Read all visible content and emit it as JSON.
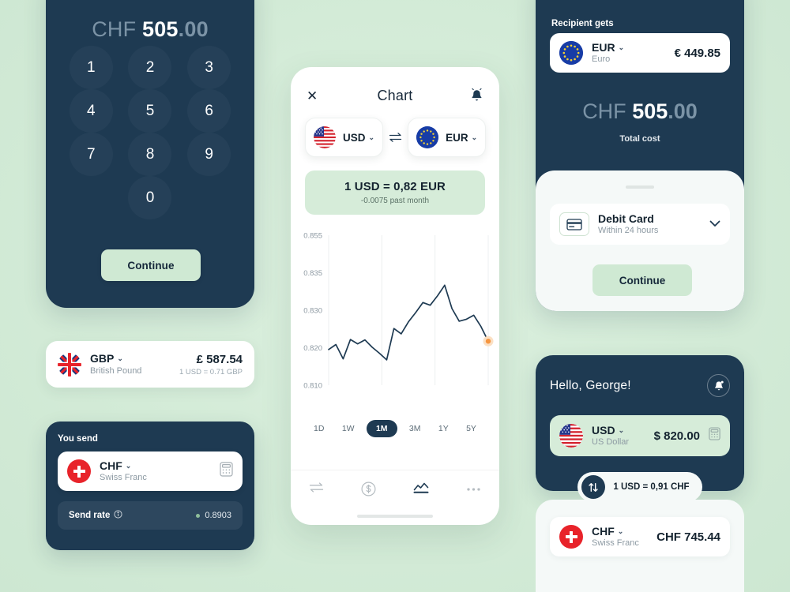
{
  "theme": {
    "background": "#d3ebd7",
    "navy": "#1e3a52",
    "mint_accent": "#cfe9d3",
    "mint_light": "#d6ecd9",
    "white": "#ffffff",
    "muted": "#8d9aa3",
    "marker": "#f6953f"
  },
  "keypad_screen": {
    "amount": {
      "currency": "CHF",
      "integer": "505",
      "decimal": ".00"
    },
    "keys": [
      "1",
      "2",
      "3",
      "4",
      "5",
      "6",
      "7",
      "8",
      "9",
      "0"
    ],
    "continue_label": "Continue"
  },
  "gbp_card": {
    "flag": "uk-flag-icon",
    "code": "GBP",
    "name": "British Pound",
    "amount": "£ 587.54",
    "rate": "1 USD = 0.71 GBP"
  },
  "you_send": {
    "title": "You send",
    "currency": {
      "flag": "switzerland-flag-icon",
      "code": "CHF",
      "name": "Swiss Franc"
    },
    "calculator_icon": "calculator-icon",
    "send_rate": {
      "label": "Send rate",
      "info_icon": "info-icon",
      "value": "0.8903"
    }
  },
  "chart_screen": {
    "close_icon": "close-icon",
    "title": "Chart",
    "bell_icon": "bell-icon",
    "from": {
      "flag": "usa-flag-icon",
      "code": "USD"
    },
    "swap_icon": "swap-horizontal-icon",
    "to": {
      "flag": "eu-flag-icon",
      "code": "EUR"
    },
    "rate_banner": {
      "main": "1 USD = 0,82 EUR",
      "sub": "-0.0075 past month"
    },
    "ranges": [
      {
        "label": "1D",
        "active": false
      },
      {
        "label": "1W",
        "active": false
      },
      {
        "label": "1M",
        "active": true
      },
      {
        "label": "3M",
        "active": false
      },
      {
        "label": "1Y",
        "active": false
      },
      {
        "label": "5Y",
        "active": false
      }
    ],
    "nav": [
      {
        "icon": "transfer-icon",
        "active": false
      },
      {
        "icon": "dollar-circle-icon",
        "active": false
      },
      {
        "icon": "chart-line-icon",
        "active": true
      },
      {
        "icon": "more-dots-icon",
        "active": false
      }
    ]
  },
  "chart_data": {
    "type": "line",
    "title": "1 USD = 0,82 EUR",
    "subtitle": "-0.0075 past month",
    "xlabel": "",
    "ylabel": "",
    "ytick_labels": [
      "0.855",
      "0.835",
      "0.830",
      "0.820",
      "0.810"
    ],
    "ylim": [
      0.81,
      0.855
    ],
    "grid": "vertical-only",
    "gridline_count": 4,
    "legend": "none",
    "line_color": "#1e3a52",
    "end_marker_color": "#f6953f",
    "series": [
      {
        "name": "USD/EUR",
        "values": [
          0.8207,
          0.8222,
          0.8179,
          0.8237,
          0.8224,
          0.8236,
          0.8214,
          0.8196,
          0.8176,
          0.827,
          0.8254,
          0.829,
          0.8318,
          0.8348,
          0.834,
          0.8368,
          0.84,
          0.833,
          0.8292,
          0.8298,
          0.831,
          0.8276,
          0.8232
        ]
      }
    ]
  },
  "send_screen": {
    "recipient_label": "Recipient gets",
    "recipient": {
      "flag": "eu-flag-icon",
      "code": "EUR",
      "name": "Euro",
      "amount": "€ 449.85"
    },
    "total": {
      "currency": "CHF",
      "integer": "505",
      "decimal": ".00"
    },
    "total_cost_label": "Total cost",
    "payment_method": {
      "icon": "credit-card-icon",
      "title": "Debit Card",
      "subtitle": "Within 24 hours",
      "chevron_icon": "chevron-down-icon"
    },
    "continue_label": "Continue"
  },
  "wallet_screen": {
    "greeting": "Hello, George!",
    "bell_icon": "bell-notification-icon",
    "from": {
      "flag": "usa-flag-icon",
      "code": "USD",
      "name": "US Dollar",
      "amount": "$ 820.00",
      "calculator_icon": "calculator-icon"
    },
    "rate_pill": {
      "swap_icon": "swap-vertical-icon",
      "text": "1 USD = 0,91 CHF"
    },
    "to": {
      "flag": "switzerland-flag-icon",
      "code": "CHF",
      "name": "Swiss Franc",
      "amount": "CHF 745.44"
    }
  }
}
